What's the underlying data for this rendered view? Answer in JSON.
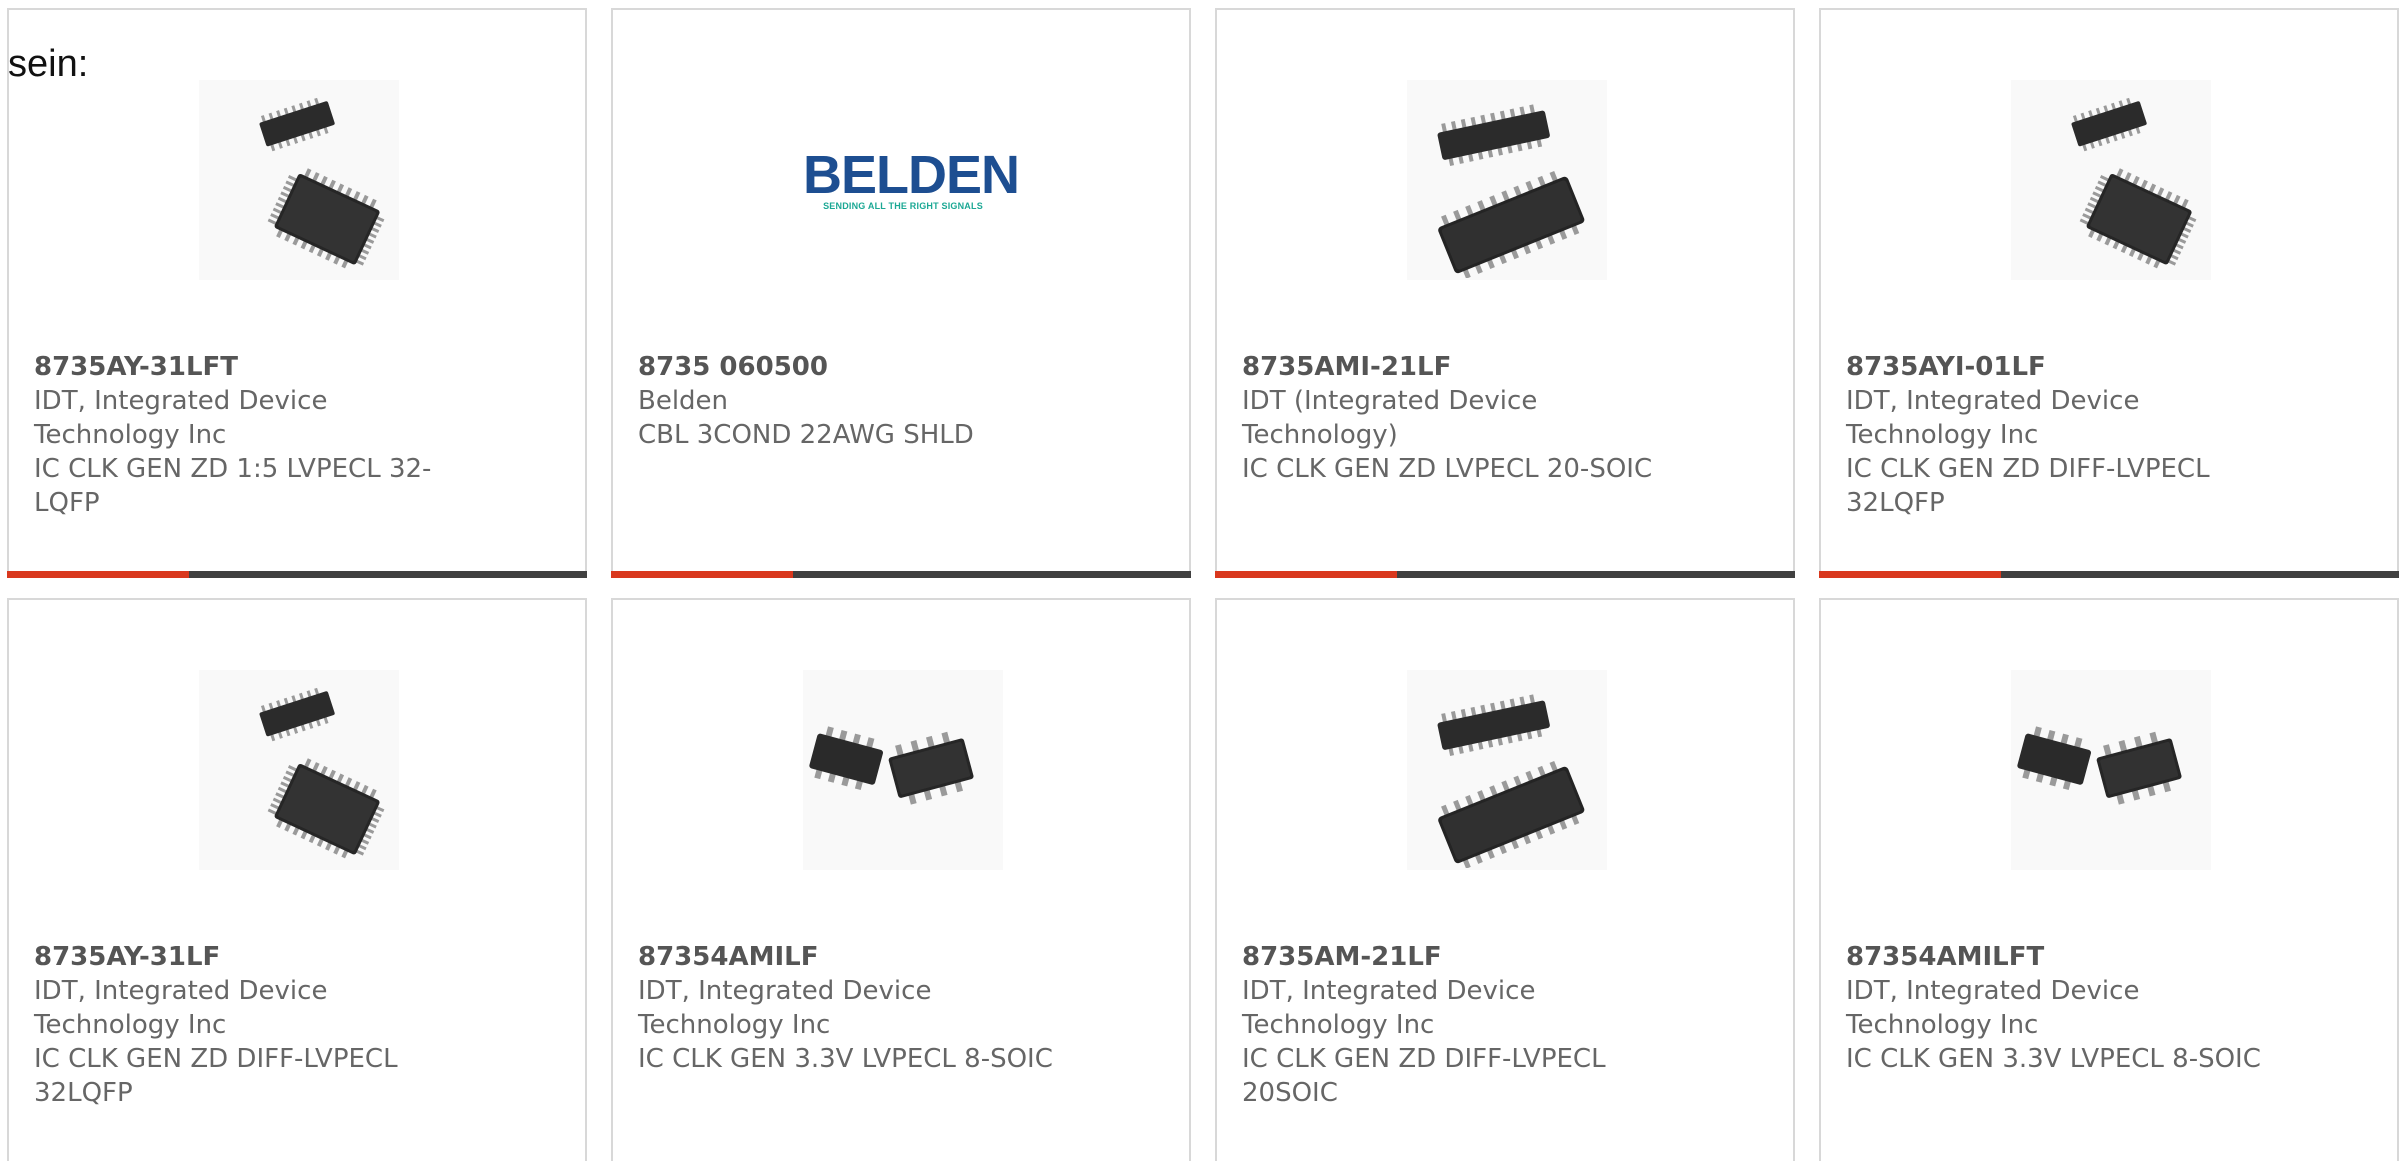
{
  "intro_text": "sein:",
  "colors": {
    "accent": "#d9381e",
    "bar": "#404040",
    "text": "#666666",
    "border": "#d8d8d8",
    "belden_blue": "#1d4e91",
    "belden_teal": "#1ba894"
  },
  "products": [
    {
      "part": "8735AY-31LFT",
      "manufacturer_lines": [
        "IDT, Integrated Device",
        "Technology Inc"
      ],
      "description_lines": [
        "IC CLK GEN ZD 1:5 LVPECL 32-",
        "LQFP"
      ],
      "image": "qfp-chip-icon"
    },
    {
      "part": "8735 060500",
      "manufacturer_lines": [
        "Belden"
      ],
      "description_lines": [
        "CBL 3COND 22AWG SHLD"
      ],
      "image": "belden-logo",
      "logo_text": "BELDEN",
      "logo_tagline": "SENDING ALL THE RIGHT SIGNALS"
    },
    {
      "part": "8735AMI-21LF",
      "manufacturer_lines": [
        "IDT (Integrated Device",
        "Technology)"
      ],
      "description_lines": [
        "IC CLK GEN ZD LVPECL 20-SOIC"
      ],
      "image": "soic-wide-chip-icon"
    },
    {
      "part": "8735AYI-01LF",
      "manufacturer_lines": [
        "IDT, Integrated Device",
        "Technology Inc"
      ],
      "description_lines": [
        "IC CLK GEN ZD DIFF-LVPECL",
        "32LQFP"
      ],
      "image": "qfp-chip-icon"
    },
    {
      "part": "8735AY-31LF",
      "manufacturer_lines": [
        "IDT, Integrated Device",
        "Technology Inc"
      ],
      "description_lines": [
        "IC CLK GEN ZD DIFF-LVPECL",
        "32LQFP"
      ],
      "image": "qfp-chip-icon"
    },
    {
      "part": "87354AMILF",
      "manufacturer_lines": [
        "IDT, Integrated Device",
        "Technology Inc"
      ],
      "description_lines": [
        "IC CLK GEN 3.3V LVPECL 8-SOIC"
      ],
      "image": "soic8-chip-icon"
    },
    {
      "part": "8735AM-21LF",
      "manufacturer_lines": [
        "IDT, Integrated Device",
        "Technology Inc"
      ],
      "description_lines": [
        "IC CLK GEN ZD DIFF-LVPECL",
        "20SOIC"
      ],
      "image": "soic-wide-chip-icon"
    },
    {
      "part": "87354AMILFT",
      "manufacturer_lines": [
        "IDT, Integrated Device",
        "Technology Inc"
      ],
      "description_lines": [
        "IC CLK GEN 3.3V LVPECL 8-SOIC"
      ],
      "image": "soic8-chip-icon"
    }
  ]
}
